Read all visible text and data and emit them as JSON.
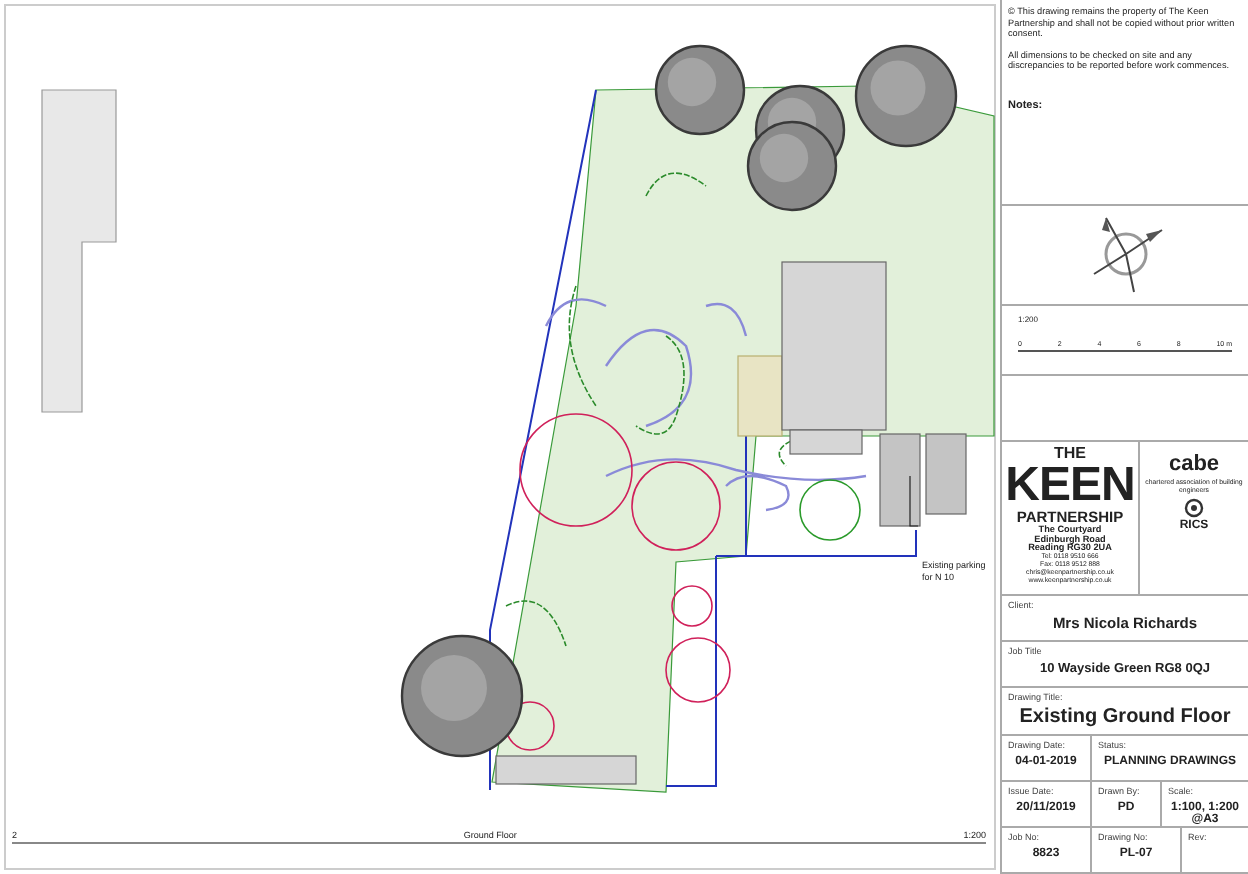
{
  "plan": {
    "parking_note": [
      "Existing parking",
      "for N 10"
    ],
    "caption": {
      "number": "2",
      "title": "Ground Floor",
      "scale": "1:200"
    }
  },
  "notes": {
    "copyright": "© This drawing remains the property of The Keen Partnership and shall not be copied without prior written consent.",
    "dimensions": "All dimensions to be checked on site and any discrepancies to be reported before work commences.",
    "label": "Notes:"
  },
  "scale_bar": {
    "label": "1:200",
    "ticks": [
      "0",
      "2",
      "4",
      "6",
      "8",
      "10 m"
    ]
  },
  "practice": {
    "the": "THE",
    "name": "KEEN",
    "partnership": "PARTNERSHIP",
    "address": [
      "The Courtyard",
      "Edinburgh Road",
      "Reading  RG30 2UA"
    ],
    "contact": [
      "Tel: 0118 9510 666",
      "Fax: 0118 9512 888"
    ],
    "web": [
      "chris@keenpartnership.co.uk",
      "www.keenpartnership.co.uk"
    ]
  },
  "memberships": {
    "cabe": "cabe",
    "cabe_caption": "chartered association of building engineers",
    "rics": "RICS"
  },
  "client": {
    "label": "Client:",
    "value": "Mrs Nicola Richards"
  },
  "job_title": {
    "label": "Job Title",
    "value": "10 Wayside Green RG8 0QJ"
  },
  "drawing_title": {
    "label": "Drawing Title:",
    "value": "Existing Ground Floor"
  },
  "field_rows": [
    [
      {
        "label": "Drawing Date:",
        "value": "04-01-2019"
      },
      {
        "label": "Status:",
        "value": "PLANNING DRAWINGS"
      }
    ],
    [
      {
        "label": "Issue Date:",
        "value": "20/11/2019"
      },
      {
        "label": "Drawn By:",
        "value": "PD"
      },
      {
        "label": "Scale:",
        "value": "1:100, 1:200 @A3"
      }
    ],
    [
      {
        "label": "Job No:",
        "value": "8823"
      },
      {
        "label": "Drawing No:",
        "value": "PL-07"
      },
      {
        "label": "Rev:"
      }
    ]
  ]
}
